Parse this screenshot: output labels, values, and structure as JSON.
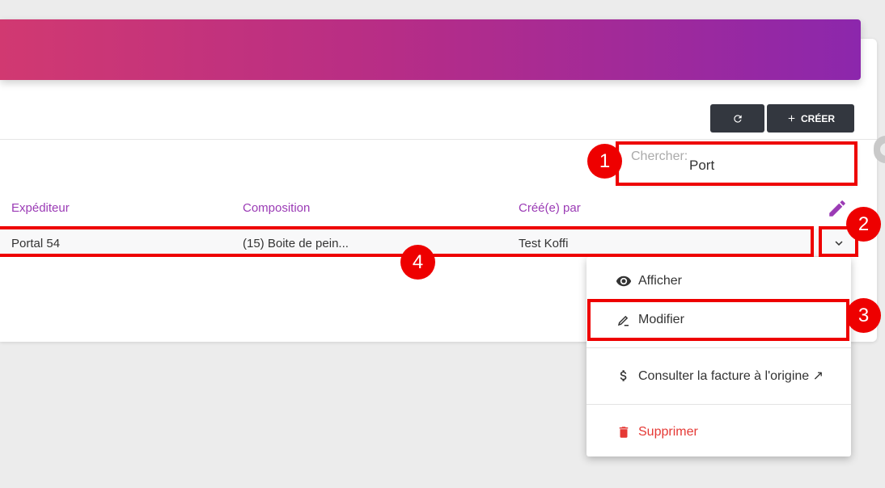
{
  "toolbar": {
    "create_label": "CRÉER",
    "refresh_icon": "refresh-icon",
    "plus_icon": "plus-icon"
  },
  "search": {
    "label": "Chercher:",
    "value": "Port"
  },
  "table": {
    "columns": [
      "Expéditeur",
      "Composition",
      "Créé(e) par"
    ],
    "rows": [
      {
        "expediteur": "Portal 54",
        "composition": "(15) Boite de pein...",
        "cree_par": "Test Koffi"
      }
    ]
  },
  "menu": {
    "items": [
      {
        "label": "Afficher",
        "icon": "eye-icon"
      },
      {
        "label": "Modifier",
        "icon": "edit-pen-icon"
      },
      {
        "label": "Consulter la facture à l'origine ↗",
        "icon": "dollar-icon"
      },
      {
        "label": "Supprimer",
        "icon": "trash-icon"
      }
    ]
  },
  "annotations": [
    "1",
    "2",
    "3",
    "4"
  ],
  "colors": {
    "gradient_start": "#d13971",
    "gradient_end": "#8c27ac",
    "accent": "#9b3bb5",
    "danger": "#e53935",
    "highlight": "#ee0000"
  }
}
